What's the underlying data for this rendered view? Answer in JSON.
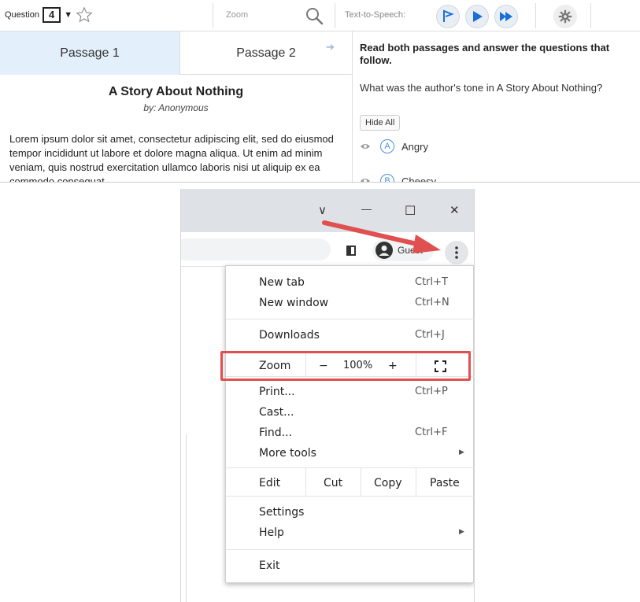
{
  "test_ui": {
    "question_label": "Question",
    "question_number": "4",
    "question_caret": "▼",
    "zoom_label": "Zoom",
    "tts_label": "Text-to-Speech:",
    "passage_tabs": [
      "Passage 1",
      "Passage 2"
    ],
    "tab_arrow": "➔",
    "story": {
      "title": "A Story About Nothing",
      "byline": "by: Anonymous",
      "body": "Lorem ipsum dolor sit amet, consectetur adipiscing elit, sed do eiusmod tempor incididunt ut labore et dolore magna aliqua. Ut enim ad minim veniam, quis nostrud exercitation ullamco laboris nisi ut aliquip ex ea commodo consequat."
    },
    "question": {
      "heading": "Read both passages and answer the questions that follow.",
      "text": "What was the author's tone in A Story About Nothing?",
      "hide_all": "Hide All",
      "answers": [
        {
          "letter": "A",
          "text": "Angry"
        },
        {
          "letter": "B",
          "text": "Cheesy"
        }
      ]
    }
  },
  "chrome": {
    "window_controls": {
      "chevron": "∨",
      "minimize": "—",
      "maximize": "☐",
      "close": "✕"
    },
    "profile_label": "Guest",
    "menu": {
      "new_tab": {
        "label": "New tab",
        "shortcut": "Ctrl+T"
      },
      "new_window": {
        "label": "New window",
        "shortcut": "Ctrl+N"
      },
      "downloads": {
        "label": "Downloads",
        "shortcut": "Ctrl+J"
      },
      "zoom": {
        "label": "Zoom",
        "minus": "−",
        "value": "100%",
        "plus": "+"
      },
      "print": {
        "label": "Print...",
        "shortcut": "Ctrl+P"
      },
      "cast": {
        "label": "Cast..."
      },
      "find": {
        "label": "Find...",
        "shortcut": "Ctrl+F"
      },
      "more_tools": {
        "label": "More tools",
        "submenu_arrow": "▶"
      },
      "edit": {
        "label": "Edit",
        "cut": "Cut",
        "copy": "Copy",
        "paste": "Paste"
      },
      "settings": {
        "label": "Settings"
      },
      "help": {
        "label": "Help",
        "submenu_arrow": "▶"
      },
      "exit": {
        "label": "Exit"
      }
    }
  },
  "colors": {
    "annotation_red": "#e05050",
    "active_tab_bg": "#e3f0fb",
    "tts_blue": "#1a6fd6",
    "chrome_titlebar": "#dee1e6"
  }
}
